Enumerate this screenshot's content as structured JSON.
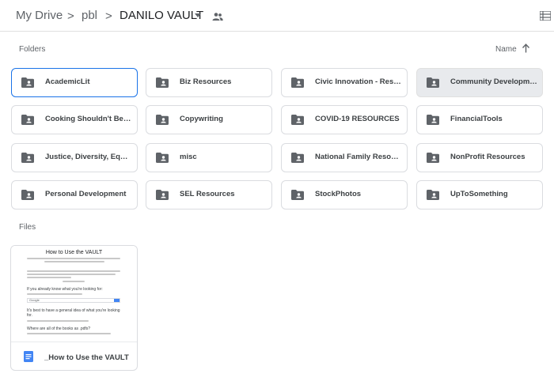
{
  "breadcrumb": {
    "root": "My Drive",
    "parent": "pbl",
    "current": "DANILO VAULT",
    "separator": ">"
  },
  "icons": {
    "shared": "people-icon",
    "view_toggle": "list-view-icon",
    "folder": "shared-folder-icon",
    "doc": "google-doc-icon",
    "sort": "arrow-up-icon"
  },
  "colors": {
    "accent": "#1a73e8",
    "icon_gray": "#5f6368",
    "doc_blue": "#4285f4"
  },
  "sections": {
    "folders_label": "Folders",
    "files_label": "Files",
    "sort_label": "Name"
  },
  "folders": [
    {
      "name": "AcademicLit",
      "selected": true
    },
    {
      "name": "Biz Resources"
    },
    {
      "name": "Civic Innovation - Rese..."
    },
    {
      "name": "Community Developme...",
      "hovered": true
    },
    {
      "name": "Cooking Shouldn't Be A..."
    },
    {
      "name": "Copywriting"
    },
    {
      "name": "COVID-19 RESOURCES"
    },
    {
      "name": "FinancialTools"
    },
    {
      "name": "Justice, Diversity, Equit..."
    },
    {
      "name": "misc"
    },
    {
      "name": "National Family Resour..."
    },
    {
      "name": "NonProfit Resources"
    },
    {
      "name": "Personal Development"
    },
    {
      "name": "SEL Resources"
    },
    {
      "name": "StockPhotos"
    },
    {
      "name": "UpToSomething"
    }
  ],
  "files": [
    {
      "name": "_How to Use the VAULT",
      "preview": {
        "title": "How to Use the VAULT",
        "heading1": "If you already know what you're looking for:",
        "heading2": "It's best to have a general idea of what you're looking for.",
        "heading3": "Where are all of the books as .pdfs?",
        "search_brand": "Google"
      }
    }
  ]
}
